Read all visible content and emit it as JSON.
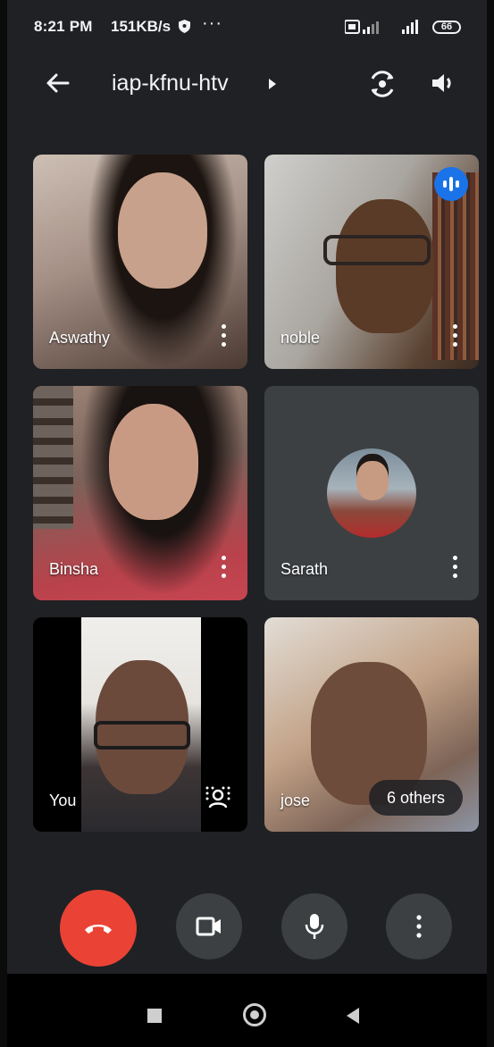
{
  "status_bar": {
    "time": "8:21 PM",
    "speed": "151KB/s",
    "overflow": "···",
    "battery": "66",
    "icons": [
      "shield-icon",
      "sim-signal-icon",
      "signal-icon",
      "battery-icon"
    ]
  },
  "header": {
    "meeting_code": "iap-kfnu-htv",
    "icons": [
      "back-arrow-icon",
      "caret-right-icon",
      "switch-camera-icon",
      "speaker-icon"
    ]
  },
  "participants": [
    {
      "name": "Aswathy",
      "has_video": true
    },
    {
      "name": "noble",
      "has_video": true,
      "speaking": true
    },
    {
      "name": "Binsha",
      "has_video": true
    },
    {
      "name": "Sarath",
      "has_video": false,
      "avatar": true
    },
    {
      "name": "You",
      "has_video": true,
      "self_view": true
    },
    {
      "name": "jose",
      "has_video": true
    }
  ],
  "others_label": "6 others",
  "controls": {
    "end_call": {
      "icon": "hang-up-icon",
      "color": "#ea4335"
    },
    "camera": {
      "icon": "video-camera-icon"
    },
    "mic": {
      "icon": "microphone-icon"
    },
    "more": {
      "icon": "more-vert-icon"
    }
  },
  "colors": {
    "background": "#202124",
    "tile_empty": "#3c4043",
    "accent_blue": "#1a73e8",
    "end_call_red": "#ea4335"
  },
  "navigation_bar": {
    "icons": [
      "recents-square-icon",
      "home-circle-icon",
      "back-triangle-icon"
    ]
  }
}
